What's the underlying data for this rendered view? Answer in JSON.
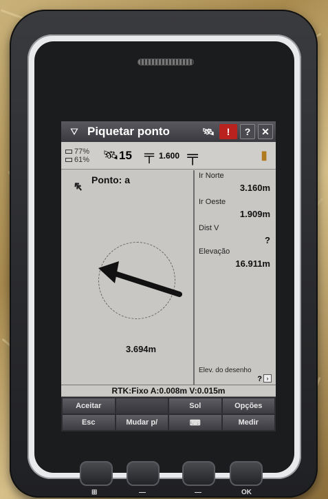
{
  "app": {
    "title": "Piquetar ponto",
    "help_label": "?",
    "close_label": "✕",
    "warn_label": "!"
  },
  "status": {
    "battery1": "77%",
    "battery2": "61%",
    "satellites": "15",
    "antenna_height": "1.600"
  },
  "nav": {
    "point_label": "Ponto: a",
    "distance": "3.694m"
  },
  "info": {
    "north_label": "Ir Norte",
    "north_value": "3.160m",
    "west_label": "Ir Oeste",
    "west_value": "1.909m",
    "vdist_label": "Dist V",
    "vdist_value": "?",
    "elev_label": "Elevação",
    "elev_value": "16.911m",
    "elev_draw_label": "Elev. do desenho",
    "elev_draw_value": "?"
  },
  "rtk": "RTK:Fixo A:0.008m V:0.015m",
  "softkeys": {
    "row1": [
      "Aceitar",
      "",
      "Sol",
      "Opções"
    ],
    "row2": [
      "Esc",
      "Mudar p/",
      "",
      "Medir"
    ]
  },
  "hardware": {
    "ok_label": "OK"
  }
}
